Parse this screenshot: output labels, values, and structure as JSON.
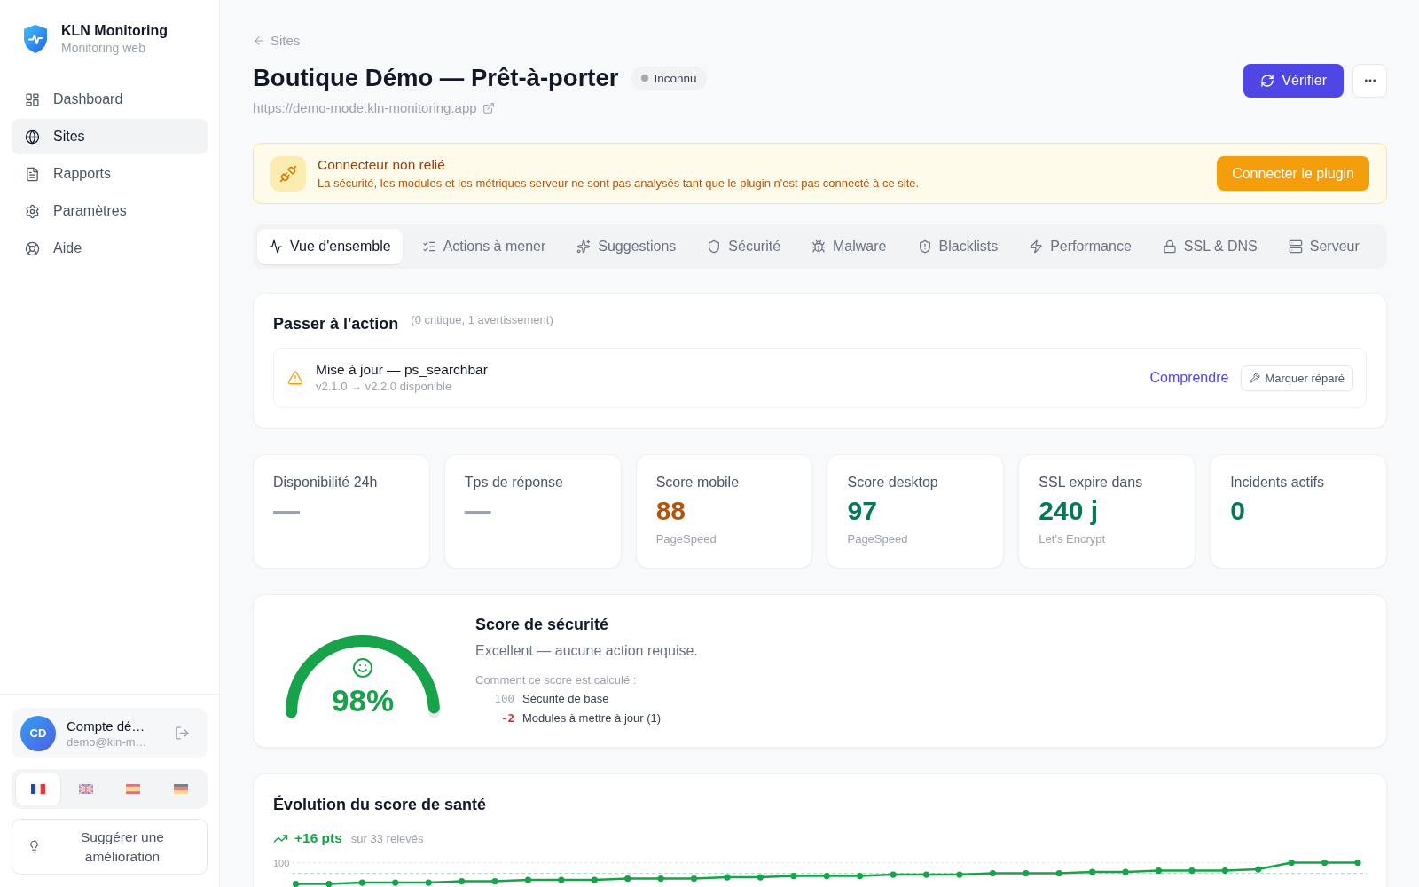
{
  "sidebar": {
    "brand": {
      "name": "KLN Monitoring",
      "subtitle": "Monitoring web"
    },
    "nav": [
      {
        "label": "Dashboard",
        "selected": false
      },
      {
        "label": "Sites",
        "selected": true
      },
      {
        "label": "Rapports",
        "selected": false
      },
      {
        "label": "Paramètres",
        "selected": false
      },
      {
        "label": "Aide",
        "selected": false
      }
    ],
    "account": {
      "initials": "CD",
      "name": "Compte dé…",
      "email": "demo@kln-m…"
    },
    "languages": [
      {
        "kind": "fr",
        "selected": true
      },
      {
        "kind": "gb",
        "selected": false
      },
      {
        "kind": "es",
        "selected": false
      },
      {
        "kind": "de",
        "selected": false
      }
    ],
    "suggest_button": "Suggérer une amélioration"
  },
  "header": {
    "back_link": "Sites",
    "title": "Boutique Démo — Prêt-à-porter",
    "status": "Inconnu",
    "url": "https://demo-mode.kln-monitoring.app",
    "verify_button": "Vérifier"
  },
  "alert": {
    "title": "Connecteur non relié",
    "message": "La sécurité, les modules et les métriques serveur ne sont pas analysés tant que le plugin n'est pas connecté à ce site.",
    "button": "Connecter le plugin"
  },
  "tabs": [
    {
      "label": "Vue d'ensemble",
      "selected": true
    },
    {
      "label": "Actions à mener",
      "selected": false
    },
    {
      "label": "Suggestions",
      "selected": false
    },
    {
      "label": "Sécurité",
      "selected": false
    },
    {
      "label": "Malware",
      "selected": false
    },
    {
      "label": "Blacklists",
      "selected": false
    },
    {
      "label": "Performance",
      "selected": false
    },
    {
      "label": "SSL & DNS",
      "selected": false
    },
    {
      "label": "Serveur",
      "selected": false
    }
  ],
  "action_card": {
    "title": "Passer à l'action",
    "summary": "(0 critique, 1 avertissement)",
    "items": [
      {
        "title": "Mise à jour — ps_searchbar",
        "detail": "v2.1.0 → v2.2.0 disponible",
        "link": "Comprendre",
        "button": "Marquer réparé"
      }
    ]
  },
  "stats": [
    {
      "label": "Disponibilité 24h",
      "value": "—",
      "color": "#9ca3af"
    },
    {
      "label": "Tps de réponse",
      "value": "—",
      "color": "#9ca3af"
    },
    {
      "label": "Score mobile",
      "value": "88",
      "note": "PageSpeed",
      "color": "#b45309"
    },
    {
      "label": "Score desktop",
      "value": "97",
      "note": "PageSpeed",
      "color": "#047857"
    },
    {
      "label": "SSL expire dans",
      "value": "240 j",
      "note": "Let's Encrypt",
      "color": "#047857"
    },
    {
      "label": "Incidents actifs",
      "value": "0",
      "color": "#047857"
    }
  ],
  "security": {
    "title": "Score de sécurité",
    "level": 0.98,
    "score": "98%",
    "verdict": "Excellent — aucune action requise.",
    "breakdown_title": "Comment ce score est calculé :",
    "breakdown": [
      {
        "kind": "base",
        "points": "100",
        "label": "Sécurité de base"
      },
      {
        "kind": "penalty",
        "points": "-2",
        "label": "Modules à mettre à jour (1)"
      }
    ]
  },
  "health": {
    "title": "Évolution du score de santé",
    "trend": "+16 pts",
    "trend_note": "sur 33 relevés",
    "axis_tick": "100"
  }
}
